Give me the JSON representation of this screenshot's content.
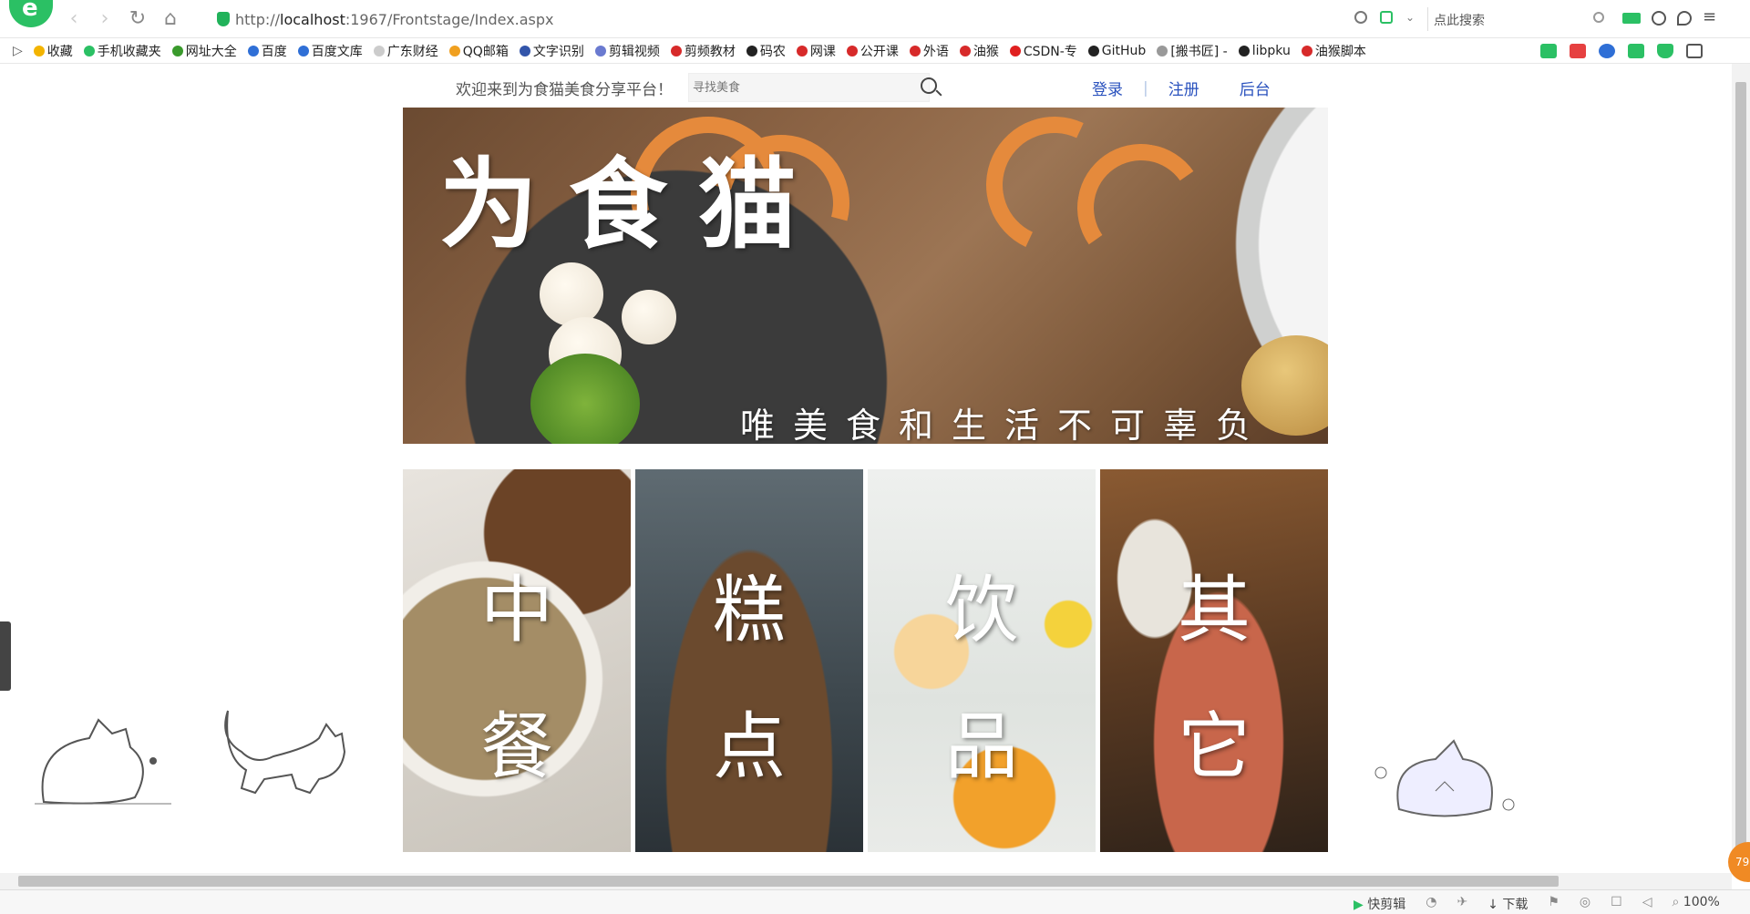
{
  "browser": {
    "url_prefix": "http://",
    "url_host": "localhost",
    "url_rest": ":1967/Frontstage/Index.aspx",
    "search_placeholder": "点此搜索",
    "zoom": "100%",
    "badge": "79"
  },
  "bookmarks": [
    {
      "label": "收藏",
      "color": "#f3b400"
    },
    {
      "label": "手机收藏夹",
      "color": "#2bc064"
    },
    {
      "label": "网址大全",
      "color": "#3a9a2c"
    },
    {
      "label": "百度",
      "color": "#2f6fd6"
    },
    {
      "label": "百度文库",
      "color": "#2f6fd6"
    },
    {
      "label": "广东财经",
      "color": "#cccccc"
    },
    {
      "label": "QQ邮箱",
      "color": "#f0a020"
    },
    {
      "label": "文字识别",
      "color": "#3355aa"
    },
    {
      "label": "剪辑视频",
      "color": "#6a7ad0"
    },
    {
      "label": "剪频教材",
      "color": "#d72a2a"
    },
    {
      "label": "码农",
      "color": "#222222"
    },
    {
      "label": "网课",
      "color": "#d72a2a"
    },
    {
      "label": "公开课",
      "color": "#d72a2a"
    },
    {
      "label": "外语",
      "color": "#d72a2a"
    },
    {
      "label": "油猴",
      "color": "#d72a2a"
    },
    {
      "label": "CSDN-专",
      "color": "#e02020"
    },
    {
      "label": "GitHub",
      "color": "#222222"
    },
    {
      "label": "[搬书匠] -",
      "color": "#999999"
    },
    {
      "label": "libpku",
      "color": "#222222"
    },
    {
      "label": "油猴脚本",
      "color": "#d72a2a"
    }
  ],
  "site": {
    "welcome": "欢迎来到为食猫美食分享平台！",
    "search_placeholder": "寻找美食",
    "nav": {
      "login": "登录",
      "sep": "|",
      "register": "注册",
      "admin": "后台"
    },
    "banner_title": "为食猫",
    "banner_slogan": "唯美食和生活不可辜负",
    "categories": [
      {
        "label": "中餐"
      },
      {
        "label": "糕点"
      },
      {
        "label": "饮品"
      },
      {
        "label": "其它"
      }
    ]
  },
  "statusbar": {
    "items": [
      "快剪辑",
      "下载"
    ]
  }
}
